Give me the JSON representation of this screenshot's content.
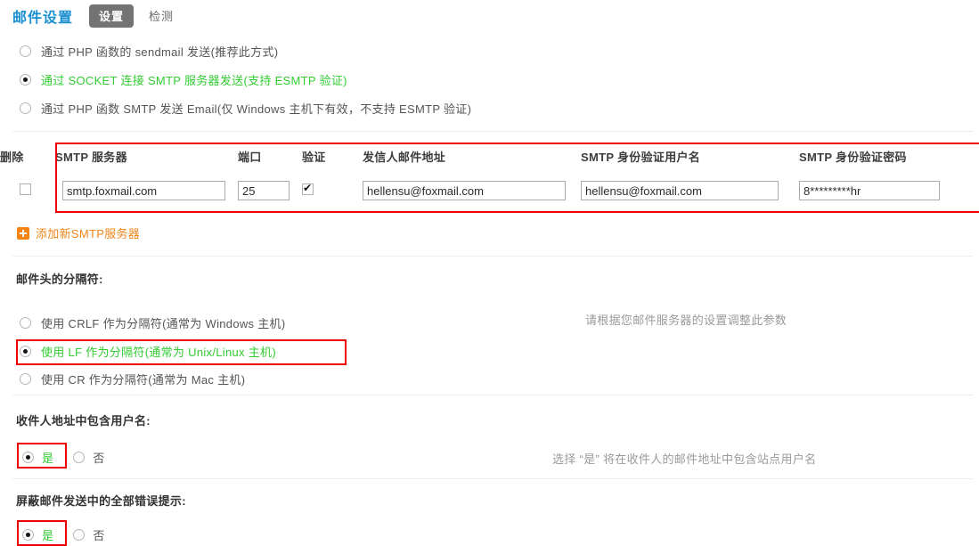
{
  "header": {
    "title": "邮件设置",
    "tabs": [
      {
        "label": "设置",
        "active": true
      },
      {
        "label": "检测",
        "active": false
      }
    ]
  },
  "send_mode": {
    "options": [
      {
        "label": "通过 PHP 函数的 sendmail 发送(推荐此方式)",
        "selected": false
      },
      {
        "label": "通过 SOCKET 连接 SMTP 服务器发送(支持 ESMTP 验证)",
        "selected": true
      },
      {
        "label": "通过 PHP 函数 SMTP 发送 Email(仅 Windows 主机下有效，不支持 ESMTP 验证)",
        "selected": false
      }
    ]
  },
  "smtp_table": {
    "headers": {
      "delete": "删除",
      "server": "SMTP 服务器",
      "port": "端口",
      "auth": "验证",
      "from": "发信人邮件地址",
      "username": "SMTP 身份验证用户名",
      "password": "SMTP 身份验证密码"
    },
    "rows": [
      {
        "delete_checked": false,
        "server": "smtp.foxmail.com",
        "port": "25",
        "auth_checked": true,
        "from": "hellensu@foxmail.com",
        "username": "hellensu@foxmail.com",
        "password": "8*********hr"
      }
    ],
    "add_link": "添加新SMTP服务器"
  },
  "separator_section": {
    "label": "邮件头的分隔符:",
    "hint": "请根据您邮件服务器的设置调整此参数",
    "options": [
      {
        "label": "使用 CRLF 作为分隔符(通常为 Windows 主机)",
        "selected": false
      },
      {
        "label": "使用 LF 作为分隔符(通常为 Unix/Linux 主机)",
        "selected": true
      },
      {
        "label": "使用 CR 作为分隔符(通常为 Mac 主机)",
        "selected": false
      }
    ]
  },
  "recipient_section": {
    "label": "收件人地址中包含用户名:",
    "hint": "选择 “是” 将在收件人的邮件地址中包含站点用户名",
    "yes_label": "是",
    "no_label": "否",
    "selected": "yes"
  },
  "suppress_section": {
    "label": "屏蔽邮件发送中的全部错误提示:",
    "yes_label": "是",
    "no_label": "否",
    "selected": "yes"
  },
  "colors": {
    "title_blue": "#1a8fd1",
    "selected_green": "#33cc33",
    "highlight_red": "#ee0000",
    "link_orange": "#f08519",
    "tab_active_bg": "#737373"
  }
}
